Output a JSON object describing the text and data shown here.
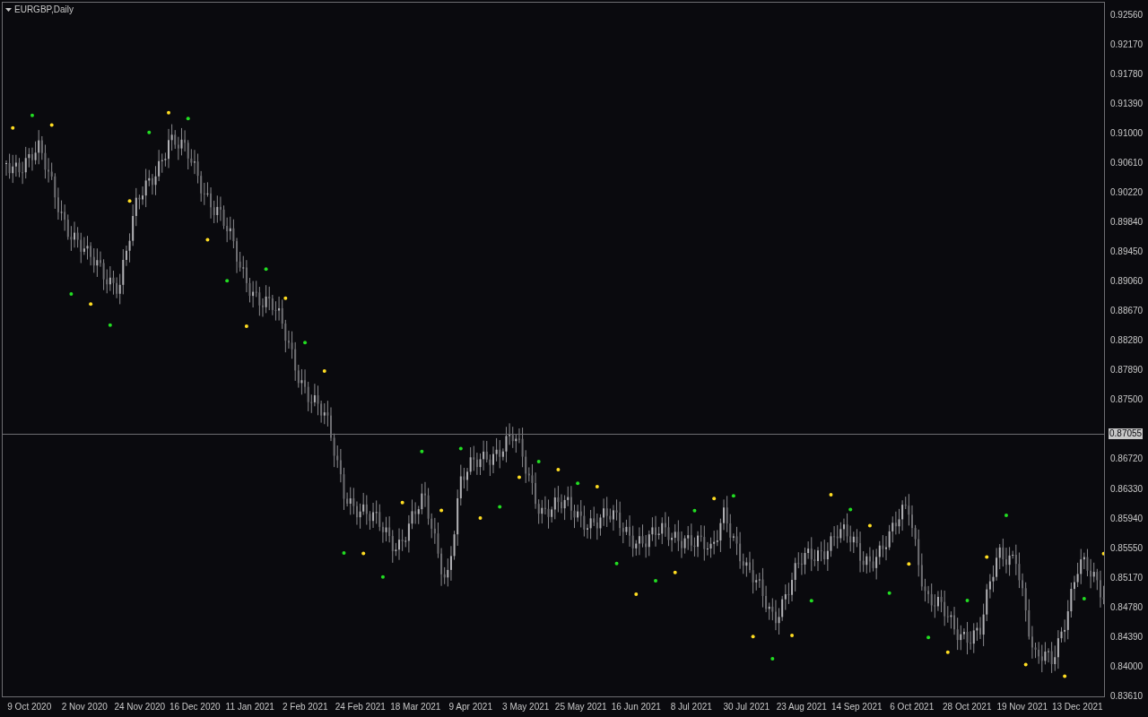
{
  "chart": {
    "title": "EURGBP,Daily",
    "current_price": "0.87055"
  },
  "price_axis_above": [
    "0.92560",
    "0.92170",
    "0.91780",
    "0.91390",
    "0.91000",
    "0.90610",
    "0.90220",
    "0.89840",
    "0.89450",
    "0.89060",
    "0.88670",
    "0.88280",
    "0.87890",
    "0.87500"
  ],
  "price_axis_below": [
    "0.86720",
    "0.86330",
    "0.85940",
    "0.85550",
    "0.85170",
    "0.84780",
    "0.84390",
    "0.84000",
    "0.83610"
  ],
  "date_axis": [
    "9 Oct 2020",
    "2 Nov 2020",
    "24 Nov 2020",
    "16 Dec 2020",
    "11 Jan 2021",
    "2 Feb 2021",
    "24 Feb 2021",
    "18 Mar 2021",
    "9 Apr 2021",
    "3 May 2021",
    "25 May 2021",
    "16 Jun 2021",
    "8 Jul 2021",
    "30 Jul 2021",
    "23 Aug 2021",
    "14 Sep 2021",
    "6 Oct 2021",
    "28 Oct 2021",
    "19 Nov 2021",
    "13 Dec 2021"
  ]
}
